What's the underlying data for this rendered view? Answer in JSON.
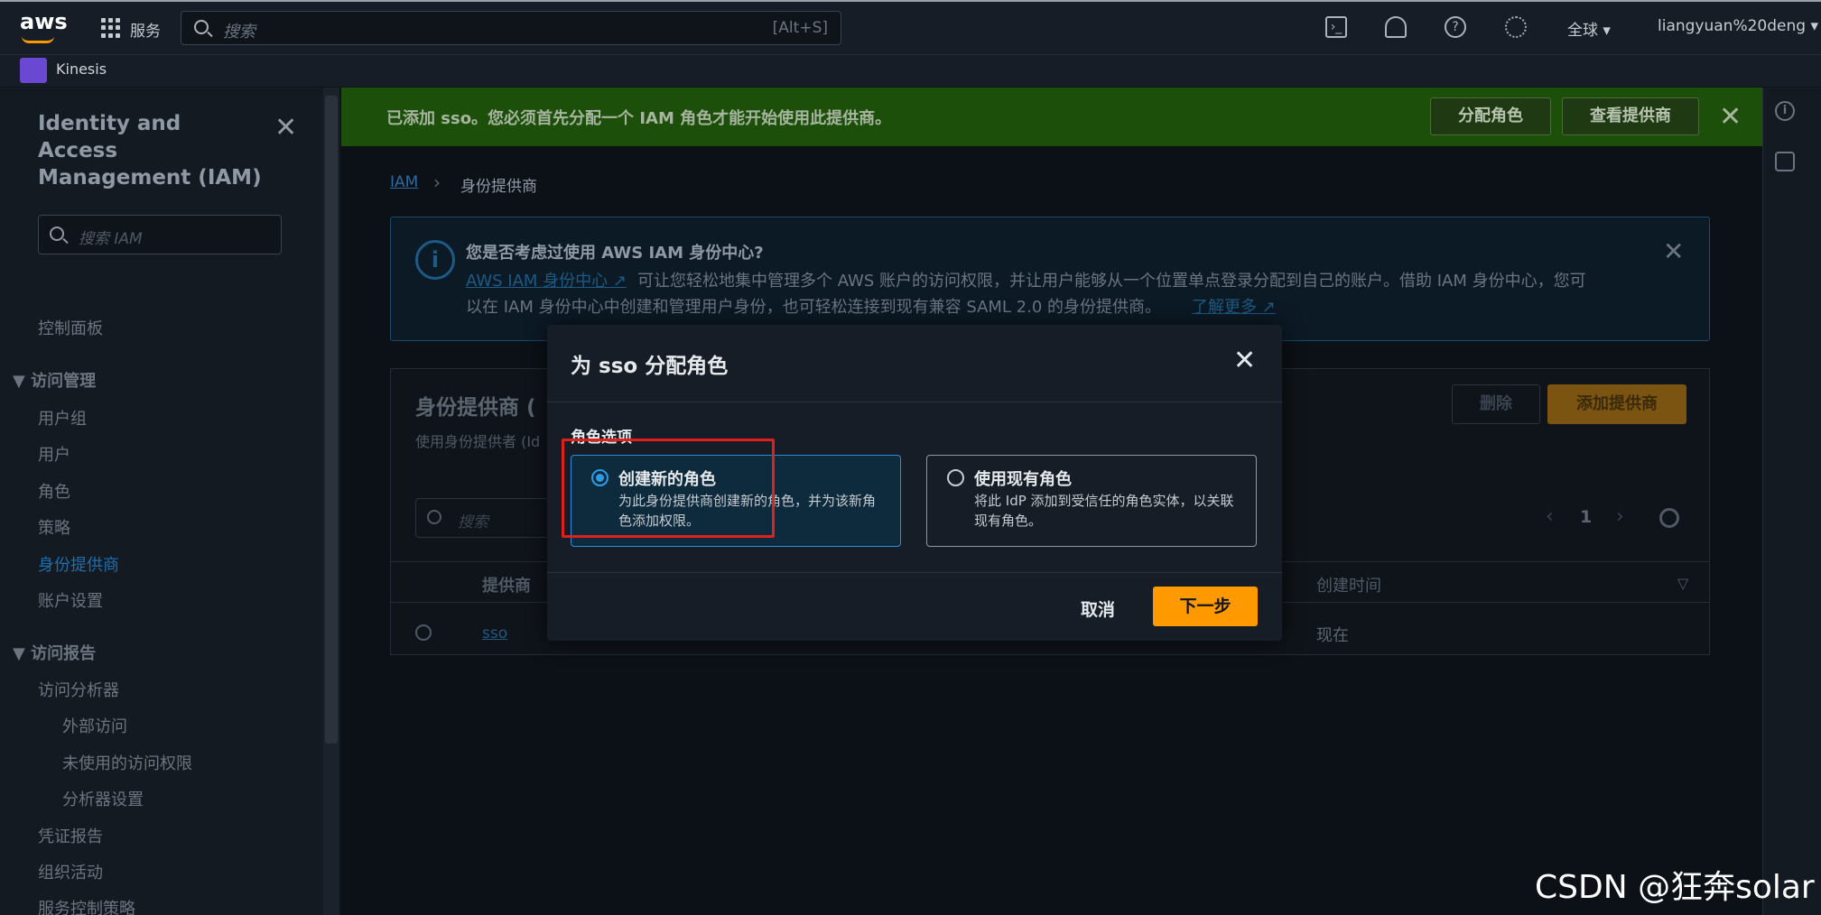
{
  "topbar": {
    "logo": "aws",
    "services_label": "服务",
    "search_placeholder": "搜索",
    "search_shortcut": "[Alt+S]",
    "region": "全球 ▾",
    "account": "liangyuan%20deng ▾",
    "icons": [
      "cloudshell-icon",
      "bell-icon",
      "help-icon",
      "gear-icon"
    ]
  },
  "subbar": {
    "service": "Kinesis"
  },
  "sidebar": {
    "title": "Identity and Access Management (IAM)",
    "search_placeholder": "搜索 IAM",
    "dashboard": "控制面板",
    "access_mgmt_head": "▼ 访问管理",
    "items": [
      "用户组",
      "用户",
      "角色",
      "策略",
      "身份提供商",
      "账户设置"
    ],
    "reports_head": "▼ 访问报告",
    "report_items": [
      "访问分析器",
      "外部访问",
      "未使用的访问权限",
      "分析器设置",
      "凭证报告",
      "组织活动",
      "服务控制策略"
    ]
  },
  "banner": {
    "text": "已添加 sso。您必须首先分配一个 IAM 角色才能开始使用此提供商。",
    "assign_role": "分配角色",
    "view_provider": "查看提供商"
  },
  "breadcrumb": {
    "root": "IAM",
    "sep": "›",
    "current": "身份提供商"
  },
  "info": {
    "title": "您是否考虑过使用 AWS IAM 身份中心?",
    "link1": "AWS IAM 身份中心 ↗",
    "line1": "可让您轻松地集中管理多个 AWS 账户的访问权限，并让用户能够从一个位置单点登录分配到自己的账户。借助 IAM 身份中心，您可",
    "line2": "以在 IAM 身份中心中创建和管理用户身份，也可轻松连接到现有兼容 SAML 2.0 的身份提供商。",
    "link2": "了解更多 ↗"
  },
  "panel": {
    "title": "身份提供商 (",
    "subtitle": "使用身份提供者 (Id",
    "delete": "删除",
    "add": "添加提供商",
    "search_placeholder": "搜索",
    "page": "1",
    "col_provider": "提供商",
    "col_created": "创建时间",
    "row_name": "sso",
    "row_created": "现在"
  },
  "modal": {
    "title": "为 sso 分配角色",
    "label": "角色选项",
    "option1_title": "创建新的角色",
    "option1_desc": "为此身份提供商创建新的角色，并为该新角色添加权限。",
    "option2_title": "使用现有角色",
    "option2_desc": "将此 IdP 添加到受信任的角色实体，以关联现有角色。",
    "cancel": "取消",
    "next": "下一步"
  },
  "watermark": "CSDN @狂奔solar",
  "colors": {
    "accent": "#ff9900",
    "banner": "#1b4f0a",
    "highlight": "#e0201b"
  }
}
